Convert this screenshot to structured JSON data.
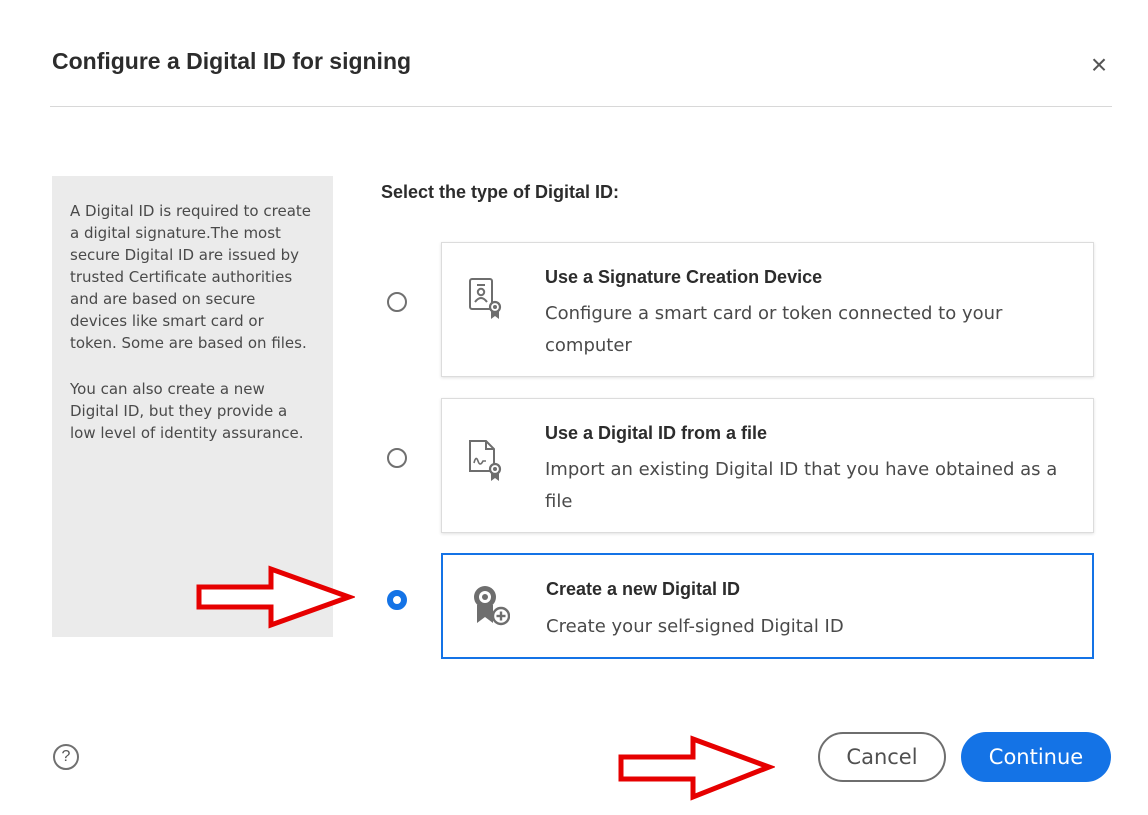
{
  "dialog": {
    "title": "Configure a Digital ID for signing",
    "close_symbol": "×"
  },
  "info": {
    "paragraph1": "A Digital ID is required to create a digital signature.The most secure Digital ID are issued by trusted Certificate authorities and are based on secure devices like smart card or token. Some are based on files.",
    "paragraph2": "You can also create a new Digital ID, but they provide a low level of identity assurance."
  },
  "select_heading": "Select the type of Digital ID:",
  "options": [
    {
      "title": "Use a Signature Creation Device",
      "description": "Configure a smart card or token connected to your computer",
      "icon": "smart-card-icon",
      "selected": false
    },
    {
      "title": "Use a Digital ID from a file",
      "description": "Import an existing Digital ID that you have obtained as a file",
      "icon": "certificate-file-icon",
      "selected": false
    },
    {
      "title": "Create a new Digital ID",
      "description": "Create your self-signed Digital ID",
      "icon": "new-certificate-icon",
      "selected": true
    }
  ],
  "footer": {
    "help_symbol": "?",
    "cancel_label": "Cancel",
    "continue_label": "Continue"
  },
  "colors": {
    "accent": "#1473e6",
    "annotation_arrow": "#e60000"
  }
}
